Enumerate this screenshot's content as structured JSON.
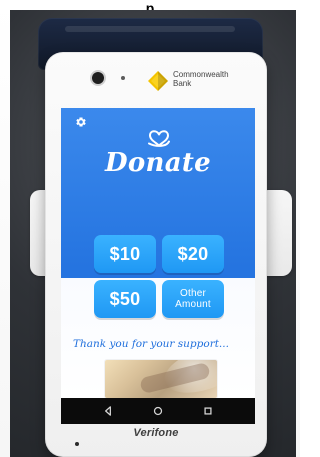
{
  "top_cut_text": "p",
  "bank": {
    "line1": "Commonwealth",
    "line2": "Bank"
  },
  "screen": {
    "title": "Donate",
    "buttons": [
      {
        "label": "$10"
      },
      {
        "label": "$20"
      },
      {
        "label": "$50"
      },
      {
        "label_line1": "Other",
        "label_line2": "Amount"
      }
    ],
    "thanks": "Thank you for your support..."
  },
  "device": {
    "brand": "Verifone"
  },
  "colors": {
    "screen_blue": "#2a7de6",
    "button_blue": "#2aa6fb",
    "thanks_blue": "#1f6fdc",
    "bank_yellow": "#f4c400"
  },
  "icons": {
    "settings": "gear-icon",
    "donate": "heart-hand-icon",
    "nav_back": "back-triangle-icon",
    "nav_home": "home-circle-icon",
    "nav_recent": "recent-square-icon"
  }
}
